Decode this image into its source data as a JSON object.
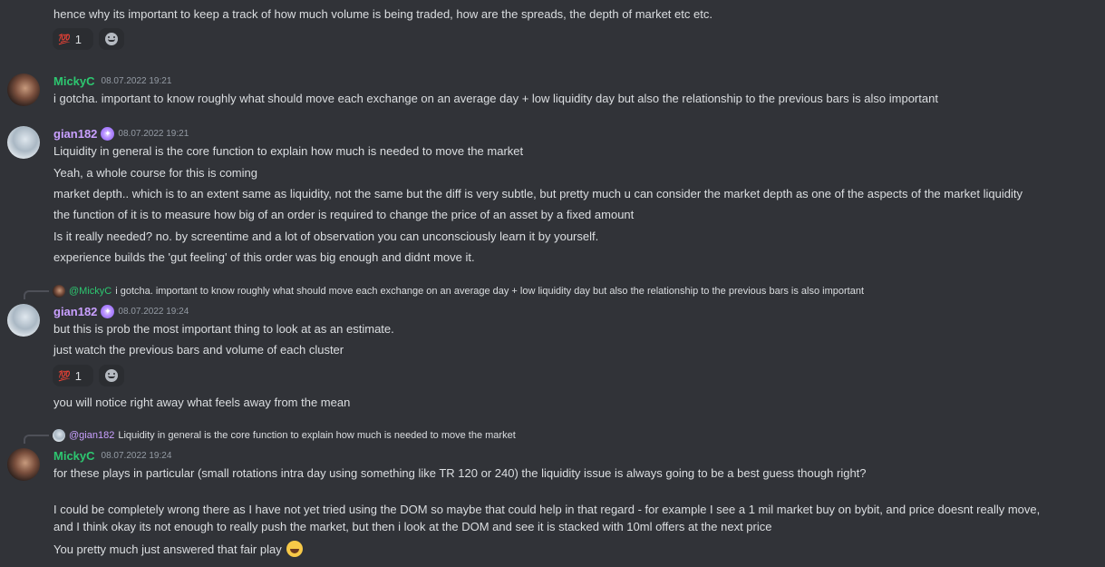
{
  "messages": {
    "m0": {
      "lines": [
        "hence why its important to keep a track of how much volume is being traded, how are the spreads, the depth of market etc etc."
      ],
      "reaction_emoji": "💯",
      "reaction_count": "1"
    },
    "m1": {
      "username": "MickyC",
      "timestamp": "08.07.2022 19:21",
      "lines": [
        "i gotcha. important to know roughly what should move each exchange on an average day + low liquidity day but also the relationship to the previous bars is also important"
      ]
    },
    "m2": {
      "username": "gian182",
      "timestamp": "08.07.2022 19:21",
      "lines": [
        "Liquidity in general is the core function to explain how much is needed to move the market",
        "Yeah, a whole course for this is coming",
        "market depth.. which is to an extent same as liquidity, not the same but the diff is very subtle, but pretty much u can consider the market depth as one of the aspects of the market liquidity",
        "the function of it is to measure how big of an order is required to change the price of an asset by a fixed amount",
        "Is it really needed? no. by screentime and a lot of observation you can unconsciously learn it by yourself.",
        "experience builds the 'gut feeling' of this order was big enough and didnt move it."
      ]
    },
    "m3": {
      "reply_mention": "@MickyC",
      "reply_text": "i gotcha. important to know roughly what should move each exchange on an average day + low liquidity day but also the relationship to the previous bars is also important",
      "username": "gian182",
      "timestamp": "08.07.2022 19:24",
      "lines": [
        "but this is prob the most important thing to look at as an estimate.",
        "just watch the previous bars and volume of each cluster"
      ],
      "reaction_emoji": "💯",
      "reaction_count": "1",
      "after_line": "you will notice right away what feels away from the mean"
    },
    "m4": {
      "reply_mention": "@gian182",
      "reply_text": "Liquidity in general is the core function to explain how much is needed to move the market",
      "username": "MickyC",
      "timestamp": "08.07.2022 19:24",
      "lines": [
        "for these plays in particular (small rotations intra day using something like TR 120 or 240) the liquidity issue is always going to be a best guess though right?",
        "I could be completely wrong there as I have not yet tried using the DOM so maybe that could help in that regard - for example I see a 1 mil market buy on bybit, and price doesnt really move,",
        "and I think okay its not enough to really push the market, but then i look at the DOM and see it is stacked with 10ml offers at the next price",
        "You pretty much just answered that fair play"
      ]
    }
  },
  "colors": {
    "background": "#313338",
    "text": "#dbdee1",
    "micky_name": "#2dc770",
    "gian_name": "#c9a0ff",
    "timestamp": "#949ba4"
  },
  "icons": {
    "add_reaction": "smiley-icon",
    "laugh_emoji": "laughing-tears-icon",
    "badge": "nitro-badge-icon"
  }
}
